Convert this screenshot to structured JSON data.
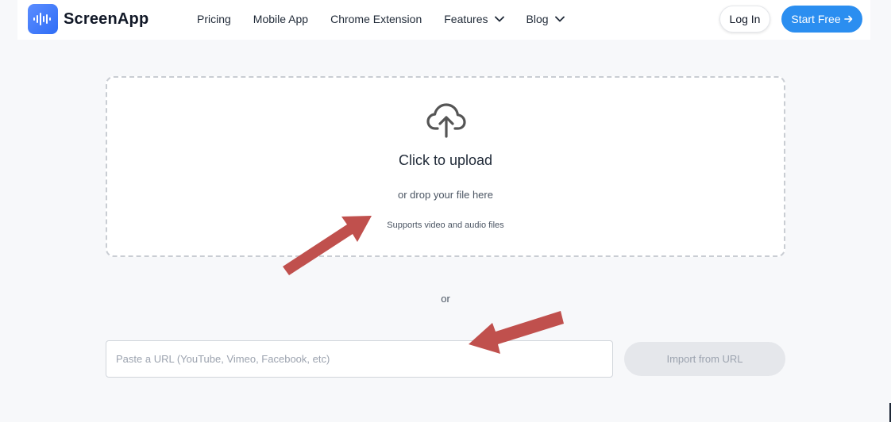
{
  "brand": {
    "name": "ScreenApp",
    "logo_color": "#3b7cf7"
  },
  "nav": {
    "items": [
      {
        "label": "Pricing",
        "has_dropdown": false
      },
      {
        "label": "Mobile App",
        "has_dropdown": false
      },
      {
        "label": "Chrome Extension",
        "has_dropdown": false
      },
      {
        "label": "Features",
        "has_dropdown": true
      },
      {
        "label": "Blog",
        "has_dropdown": true
      }
    ],
    "login_label": "Log In",
    "start_label": "Start Free",
    "start_color": "#2b8ef0"
  },
  "upload": {
    "icon": "cloud-upload-icon",
    "title": "Click to upload",
    "subtitle": "or drop your file here",
    "note": "Supports video and audio files"
  },
  "divider_text": "or",
  "url_import": {
    "placeholder": "Paste a URL (YouTube, Vimeo, Facebook, etc)",
    "value": "",
    "button_label": "Import from URL",
    "button_enabled": false
  },
  "annotations": {
    "arrow_color": "#c0504d"
  }
}
